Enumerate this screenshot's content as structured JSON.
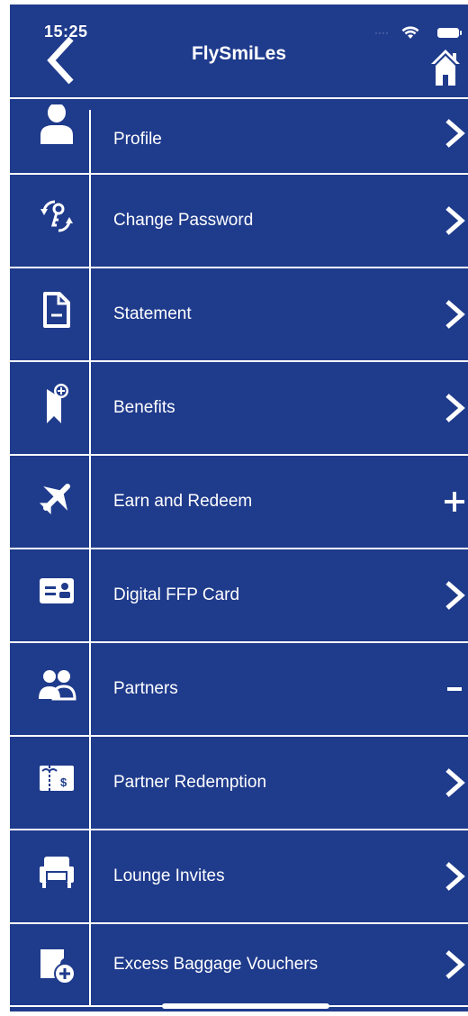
{
  "status": {
    "time": "15:25"
  },
  "header": {
    "title": "FlySmiLes"
  },
  "menu": {
    "items": [
      {
        "label": "Profile",
        "icon": "person-icon",
        "action": "chevron"
      },
      {
        "label": "Change Password",
        "icon": "password-change-icon",
        "action": "chevron"
      },
      {
        "label": "Statement",
        "icon": "document-icon",
        "action": "chevron"
      },
      {
        "label": "Benefits",
        "icon": "ribbon-plus-icon",
        "action": "chevron"
      },
      {
        "label": "Earn and Redeem",
        "icon": "airplane-icon",
        "action": "plus"
      },
      {
        "label": "Digital FFP Card",
        "icon": "id-card-icon",
        "action": "chevron"
      },
      {
        "label": "Partners",
        "icon": "partners-icon",
        "action": "minus"
      },
      {
        "label": "Partner Redemption",
        "icon": "gift-voucher-icon",
        "action": "chevron"
      },
      {
        "label": "Lounge Invites",
        "icon": "lounge-chair-icon",
        "action": "chevron"
      },
      {
        "label": "Excess Baggage Vouchers",
        "icon": "baggage-voucher-icon",
        "action": "chevron"
      }
    ]
  },
  "colors": {
    "background": "#1f3b8c",
    "foreground": "#ffffff"
  }
}
